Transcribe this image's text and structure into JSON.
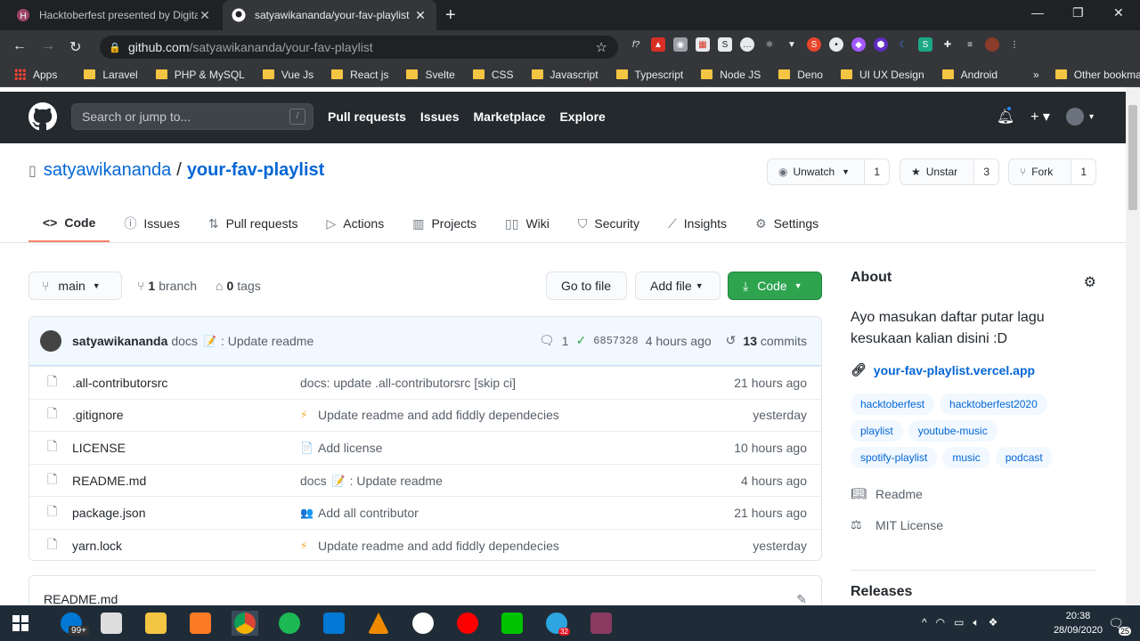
{
  "browser": {
    "tabs": [
      {
        "title": "Hacktoberfest presented by DigitalOcean",
        "active": false
      },
      {
        "title": "satyawikananda/your-fav-playlist",
        "active": true
      }
    ],
    "url_host": "github.com",
    "url_path": "/satyawikananda/your-fav-playlist",
    "bookmarks": [
      "Apps",
      "Laravel",
      "PHP & MySQL",
      "Vue Js",
      "React js",
      "Svelte",
      "CSS",
      "Javascript",
      "Typescript",
      "Node JS",
      "Deno",
      "UI UX Design",
      "Android"
    ],
    "more_bookmarks": "»",
    "other_bookmarks": "Other bookmarks"
  },
  "github": {
    "search_placeholder": "Search or jump to...",
    "search_hint": "/",
    "nav": [
      "Pull requests",
      "Issues",
      "Marketplace",
      "Explore"
    ]
  },
  "repo": {
    "owner": "satyawikananda",
    "separator": "/",
    "name": "your-fav-playlist",
    "watch_label": "Unwatch",
    "watch_count": "1",
    "star_label": "Unstar",
    "star_count": "3",
    "fork_label": "Fork",
    "fork_count": "1",
    "tabs": [
      "Code",
      "Issues",
      "Pull requests",
      "Actions",
      "Projects",
      "Wiki",
      "Security",
      "Insights",
      "Settings"
    ],
    "branch": "main",
    "branch_count": "1",
    "branch_label": "branch",
    "tag_count": "0",
    "tag_label": "tags",
    "go_to_file": "Go to file",
    "add_file": "Add file",
    "code_button": "Code"
  },
  "latest_commit": {
    "user": "satyawikananda",
    "message_prefix": "docs",
    "message": ": Update readme",
    "comments": "1",
    "sha": "6857328",
    "time": "4 hours ago",
    "commit_count": "13",
    "commit_label": "commits"
  },
  "files": [
    {
      "name": ".all-contributorsrc",
      "message": "docs: update .all-contributorsrc [skip ci]",
      "age": "21 hours ago"
    },
    {
      "name": ".gitignore",
      "message": "Update readme and add fiddly dependecies",
      "age": "yesterday"
    },
    {
      "name": "LICENSE",
      "message": "Add license",
      "age": "10 hours ago"
    },
    {
      "name": "README.md",
      "message": ": Update readme",
      "message_prefix": "docs",
      "age": "4 hours ago"
    },
    {
      "name": "package.json",
      "message": "Add all contributor",
      "age": "21 hours ago"
    },
    {
      "name": "yarn.lock",
      "message": "Update readme and add fiddly dependecies",
      "age": "yesterday"
    }
  ],
  "readme": {
    "title": "README.md"
  },
  "about": {
    "title": "About",
    "description": "Ayo masukan daftar putar lagu kesukaan kalian disini :D",
    "website": "your-fav-playlist.vercel.app",
    "topics": [
      "hacktoberfest",
      "hacktoberfest2020",
      "playlist",
      "youtube-music",
      "spotify-playlist",
      "music",
      "podcast"
    ],
    "readme_label": "Readme",
    "license_label": "MIT License",
    "releases_title": "Releases"
  },
  "taskbar": {
    "mail_badge": "99+",
    "telegram_badge": "32",
    "time": "20:38",
    "date": "28/09/2020",
    "notification_count": "25"
  }
}
